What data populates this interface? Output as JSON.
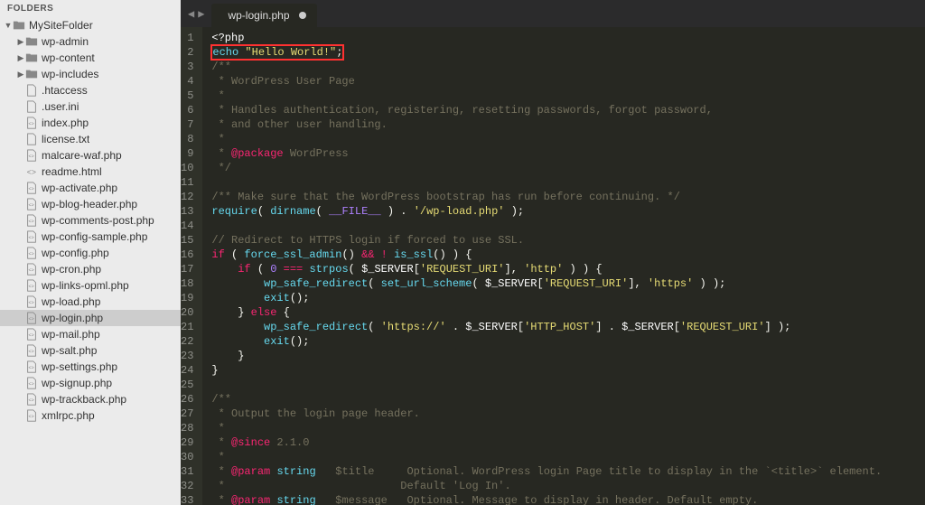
{
  "sidebar": {
    "title": "FOLDERS",
    "tree": [
      {
        "depth": 0,
        "type": "folder",
        "expanded": true,
        "label": "MySiteFolder",
        "name": "folder-mysitefolder",
        "interactable": true
      },
      {
        "depth": 1,
        "type": "folder",
        "expanded": false,
        "label": "wp-admin",
        "name": "folder-wp-admin",
        "interactable": true
      },
      {
        "depth": 1,
        "type": "folder",
        "expanded": false,
        "label": "wp-content",
        "name": "folder-wp-content",
        "interactable": true
      },
      {
        "depth": 1,
        "type": "folder",
        "expanded": false,
        "label": "wp-includes",
        "name": "folder-wp-includes",
        "interactable": true
      },
      {
        "depth": 1,
        "type": "file",
        "label": ".htaccess",
        "name": "file-htaccess",
        "interactable": true
      },
      {
        "depth": 1,
        "type": "file",
        "label": ".user.ini",
        "name": "file-user-ini",
        "interactable": true
      },
      {
        "depth": 1,
        "type": "php",
        "label": "index.php",
        "name": "file-index-php",
        "interactable": true
      },
      {
        "depth": 1,
        "type": "file",
        "label": "license.txt",
        "name": "file-license-txt",
        "interactable": true
      },
      {
        "depth": 1,
        "type": "php",
        "label": "malcare-waf.php",
        "name": "file-malcare-waf-php",
        "interactable": true
      },
      {
        "depth": 1,
        "type": "html",
        "label": "readme.html",
        "name": "file-readme-html",
        "interactable": true
      },
      {
        "depth": 1,
        "type": "php",
        "label": "wp-activate.php",
        "name": "file-wp-activate-php",
        "interactable": true
      },
      {
        "depth": 1,
        "type": "php",
        "label": "wp-blog-header.php",
        "name": "file-wp-blog-header-php",
        "interactable": true
      },
      {
        "depth": 1,
        "type": "php",
        "label": "wp-comments-post.php",
        "name": "file-wp-comments-post-php",
        "interactable": true
      },
      {
        "depth": 1,
        "type": "php",
        "label": "wp-config-sample.php",
        "name": "file-wp-config-sample-php",
        "interactable": true
      },
      {
        "depth": 1,
        "type": "php",
        "label": "wp-config.php",
        "name": "file-wp-config-php",
        "interactable": true
      },
      {
        "depth": 1,
        "type": "php",
        "label": "wp-cron.php",
        "name": "file-wp-cron-php",
        "interactable": true
      },
      {
        "depth": 1,
        "type": "php",
        "label": "wp-links-opml.php",
        "name": "file-wp-links-opml-php",
        "interactable": true
      },
      {
        "depth": 1,
        "type": "php",
        "label": "wp-load.php",
        "name": "file-wp-load-php",
        "interactable": true
      },
      {
        "depth": 1,
        "type": "php",
        "label": "wp-login.php",
        "name": "file-wp-login-php",
        "interactable": true,
        "selected": true
      },
      {
        "depth": 1,
        "type": "php",
        "label": "wp-mail.php",
        "name": "file-wp-mail-php",
        "interactable": true
      },
      {
        "depth": 1,
        "type": "php",
        "label": "wp-salt.php",
        "name": "file-wp-salt-php",
        "interactable": true
      },
      {
        "depth": 1,
        "type": "php",
        "label": "wp-settings.php",
        "name": "file-wp-settings-php",
        "interactable": true
      },
      {
        "depth": 1,
        "type": "php",
        "label": "wp-signup.php",
        "name": "file-wp-signup-php",
        "interactable": true
      },
      {
        "depth": 1,
        "type": "php",
        "label": "wp-trackback.php",
        "name": "file-wp-trackback-php",
        "interactable": true
      },
      {
        "depth": 1,
        "type": "php",
        "label": "xmlrpc.php",
        "name": "file-xmlrpc-php",
        "interactable": true
      }
    ]
  },
  "top": {
    "tab_label": "wp-login.php",
    "dirty": true
  },
  "code": {
    "lines": [
      {
        "n": 1,
        "tokens": [
          {
            "t": "<?php",
            "c": "#fff"
          }
        ]
      },
      {
        "n": 2,
        "highlight": true,
        "tokens": [
          {
            "t": "echo ",
            "c": "#66d9ef"
          },
          {
            "t": "\"Hello World!\"",
            "c": "#e6db74"
          },
          {
            "t": ";",
            "c": "#f8f8f2"
          }
        ]
      },
      {
        "n": 3,
        "tokens": [
          {
            "t": "/**",
            "c": "#75715e"
          }
        ]
      },
      {
        "n": 4,
        "tokens": [
          {
            "t": " * WordPress User Page",
            "c": "#75715e"
          }
        ]
      },
      {
        "n": 5,
        "tokens": [
          {
            "t": " *",
            "c": "#75715e"
          }
        ]
      },
      {
        "n": 6,
        "tokens": [
          {
            "t": " * Handles authentication, registering, resetting passwords, forgot password,",
            "c": "#75715e"
          }
        ]
      },
      {
        "n": 7,
        "tokens": [
          {
            "t": " * and other user handling.",
            "c": "#75715e"
          }
        ]
      },
      {
        "n": 8,
        "tokens": [
          {
            "t": " *",
            "c": "#75715e"
          }
        ]
      },
      {
        "n": 9,
        "tokens": [
          {
            "t": " * ",
            "c": "#75715e"
          },
          {
            "t": "@package",
            "c": "#f92672"
          },
          {
            "t": " WordPress",
            "c": "#75715e"
          }
        ]
      },
      {
        "n": 10,
        "tokens": [
          {
            "t": " */",
            "c": "#75715e"
          }
        ]
      },
      {
        "n": 11,
        "tokens": []
      },
      {
        "n": 12,
        "tokens": [
          {
            "t": "/** Make sure that the WordPress bootstrap has run before continuing. */",
            "c": "#75715e"
          }
        ]
      },
      {
        "n": 13,
        "tokens": [
          {
            "t": "require",
            "c": "#66d9ef"
          },
          {
            "t": "( ",
            "c": "#f8f8f2"
          },
          {
            "t": "dirname",
            "c": "#66d9ef"
          },
          {
            "t": "( ",
            "c": "#f8f8f2"
          },
          {
            "t": "__FILE__",
            "c": "#ae81ff"
          },
          {
            "t": " ) . ",
            "c": "#f8f8f2"
          },
          {
            "t": "'/wp-load.php'",
            "c": "#e6db74"
          },
          {
            "t": " );",
            "c": "#f8f8f2"
          }
        ]
      },
      {
        "n": 14,
        "tokens": []
      },
      {
        "n": 15,
        "tokens": [
          {
            "t": "// Redirect to HTTPS login if forced to use SSL.",
            "c": "#75715e"
          }
        ]
      },
      {
        "n": 16,
        "tokens": [
          {
            "t": "if",
            "c": "#f92672"
          },
          {
            "t": " ( ",
            "c": "#f8f8f2"
          },
          {
            "t": "force_ssl_admin",
            "c": "#66d9ef"
          },
          {
            "t": "() ",
            "c": "#f8f8f2"
          },
          {
            "t": "&&",
            "c": "#f92672"
          },
          {
            "t": " ",
            "c": "#f8f8f2"
          },
          {
            "t": "!",
            "c": "#f92672"
          },
          {
            "t": " ",
            "c": "#f8f8f2"
          },
          {
            "t": "is_ssl",
            "c": "#66d9ef"
          },
          {
            "t": "() ) {",
            "c": "#f8f8f2"
          }
        ]
      },
      {
        "n": 17,
        "tokens": [
          {
            "t": "    ",
            "c": "#f8f8f2"
          },
          {
            "t": "if",
            "c": "#f92672"
          },
          {
            "t": " ( ",
            "c": "#f8f8f2"
          },
          {
            "t": "0",
            "c": "#ae81ff"
          },
          {
            "t": " ",
            "c": "#f8f8f2"
          },
          {
            "t": "===",
            "c": "#f92672"
          },
          {
            "t": " ",
            "c": "#f8f8f2"
          },
          {
            "t": "strpos",
            "c": "#66d9ef"
          },
          {
            "t": "( ",
            "c": "#f8f8f2"
          },
          {
            "t": "$_SERVER",
            "c": "#fff"
          },
          {
            "t": "[",
            "c": "#f8f8f2"
          },
          {
            "t": "'REQUEST_URI'",
            "c": "#e6db74"
          },
          {
            "t": "], ",
            "c": "#f8f8f2"
          },
          {
            "t": "'http'",
            "c": "#e6db74"
          },
          {
            "t": " ) ) {",
            "c": "#f8f8f2"
          }
        ]
      },
      {
        "n": 18,
        "tokens": [
          {
            "t": "        ",
            "c": "#f8f8f2"
          },
          {
            "t": "wp_safe_redirect",
            "c": "#66d9ef"
          },
          {
            "t": "( ",
            "c": "#f8f8f2"
          },
          {
            "t": "set_url_scheme",
            "c": "#66d9ef"
          },
          {
            "t": "( ",
            "c": "#f8f8f2"
          },
          {
            "t": "$_SERVER",
            "c": "#fff"
          },
          {
            "t": "[",
            "c": "#f8f8f2"
          },
          {
            "t": "'REQUEST_URI'",
            "c": "#e6db74"
          },
          {
            "t": "], ",
            "c": "#f8f8f2"
          },
          {
            "t": "'https'",
            "c": "#e6db74"
          },
          {
            "t": " ) );",
            "c": "#f8f8f2"
          }
        ]
      },
      {
        "n": 19,
        "tokens": [
          {
            "t": "        ",
            "c": "#f8f8f2"
          },
          {
            "t": "exit",
            "c": "#66d9ef"
          },
          {
            "t": "();",
            "c": "#f8f8f2"
          }
        ]
      },
      {
        "n": 20,
        "tokens": [
          {
            "t": "    } ",
            "c": "#f8f8f2"
          },
          {
            "t": "else",
            "c": "#f92672"
          },
          {
            "t": " {",
            "c": "#f8f8f2"
          }
        ]
      },
      {
        "n": 21,
        "tokens": [
          {
            "t": "        ",
            "c": "#f8f8f2"
          },
          {
            "t": "wp_safe_redirect",
            "c": "#66d9ef"
          },
          {
            "t": "( ",
            "c": "#f8f8f2"
          },
          {
            "t": "'https://'",
            "c": "#e6db74"
          },
          {
            "t": " . ",
            "c": "#f8f8f2"
          },
          {
            "t": "$_SERVER",
            "c": "#fff"
          },
          {
            "t": "[",
            "c": "#f8f8f2"
          },
          {
            "t": "'HTTP_HOST'",
            "c": "#e6db74"
          },
          {
            "t": "] . ",
            "c": "#f8f8f2"
          },
          {
            "t": "$_SERVER",
            "c": "#fff"
          },
          {
            "t": "[",
            "c": "#f8f8f2"
          },
          {
            "t": "'REQUEST_URI'",
            "c": "#e6db74"
          },
          {
            "t": "] );",
            "c": "#f8f8f2"
          }
        ]
      },
      {
        "n": 22,
        "tokens": [
          {
            "t": "        ",
            "c": "#f8f8f2"
          },
          {
            "t": "exit",
            "c": "#66d9ef"
          },
          {
            "t": "();",
            "c": "#f8f8f2"
          }
        ]
      },
      {
        "n": 23,
        "tokens": [
          {
            "t": "    }",
            "c": "#f8f8f2"
          }
        ]
      },
      {
        "n": 24,
        "tokens": [
          {
            "t": "}",
            "c": "#f8f8f2"
          }
        ]
      },
      {
        "n": 25,
        "tokens": []
      },
      {
        "n": 26,
        "tokens": [
          {
            "t": "/**",
            "c": "#75715e"
          }
        ]
      },
      {
        "n": 27,
        "tokens": [
          {
            "t": " * Output the login page header.",
            "c": "#75715e"
          }
        ]
      },
      {
        "n": 28,
        "tokens": [
          {
            "t": " *",
            "c": "#75715e"
          }
        ]
      },
      {
        "n": 29,
        "tokens": [
          {
            "t": " * ",
            "c": "#75715e"
          },
          {
            "t": "@since",
            "c": "#f92672"
          },
          {
            "t": " 2.1.0",
            "c": "#75715e"
          }
        ]
      },
      {
        "n": 30,
        "tokens": [
          {
            "t": " *",
            "c": "#75715e"
          }
        ]
      },
      {
        "n": 31,
        "tokens": [
          {
            "t": " * ",
            "c": "#75715e"
          },
          {
            "t": "@param",
            "c": "#f92672"
          },
          {
            "t": " ",
            "c": "#75715e"
          },
          {
            "t": "string",
            "c": "#66d9ef"
          },
          {
            "t": "   $title     Optional. WordPress login Page title to display in the `<title>` element.",
            "c": "#75715e"
          }
        ]
      },
      {
        "n": 32,
        "tokens": [
          {
            "t": " *                           Default 'Log In'.",
            "c": "#75715e"
          }
        ]
      },
      {
        "n": 33,
        "tokens": [
          {
            "t": " * ",
            "c": "#75715e"
          },
          {
            "t": "@param",
            "c": "#f92672"
          },
          {
            "t": " ",
            "c": "#75715e"
          },
          {
            "t": "string",
            "c": "#66d9ef"
          },
          {
            "t": "   $message   Optional. Message to display in header. Default empty.",
            "c": "#75715e"
          }
        ]
      }
    ]
  }
}
